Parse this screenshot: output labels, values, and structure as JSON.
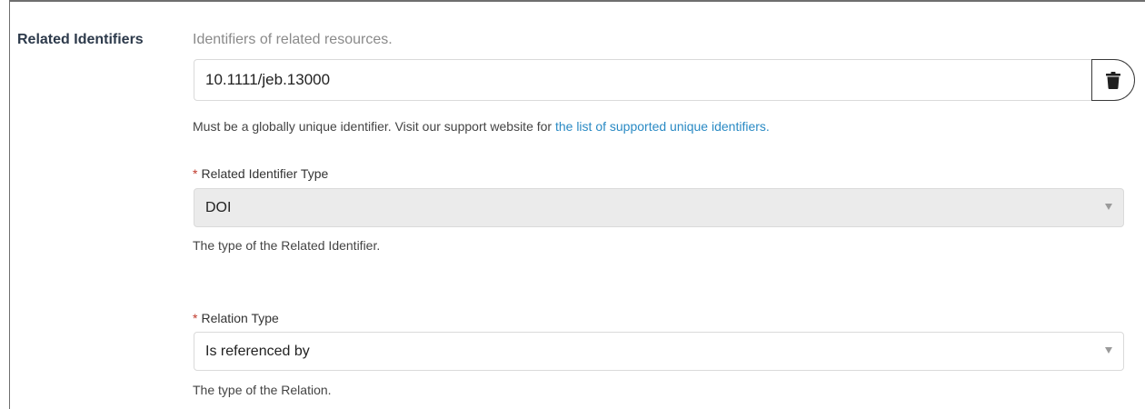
{
  "section": {
    "label": "Related Identifiers",
    "description": "Identifiers of related resources."
  },
  "identifier": {
    "value": "10.1111/jeb.13000",
    "help_prefix": "Must be a globally unique identifier. Visit our support website for ",
    "help_link": "the list of supported unique identifiers."
  },
  "identifier_type": {
    "required_marker": "*",
    "label": "Related Identifier Type",
    "selected": "DOI",
    "note": "The type of the Related Identifier."
  },
  "relation_type": {
    "required_marker": "*",
    "label": "Relation Type",
    "selected": "Is referenced by",
    "note": "The type of the Relation."
  },
  "icons": {
    "delete": "trash-icon",
    "dropdown": "caret-down-icon"
  },
  "colors": {
    "link": "#2a8ac4",
    "required": "#c0392b",
    "disabled_bg": "#ebebeb"
  }
}
